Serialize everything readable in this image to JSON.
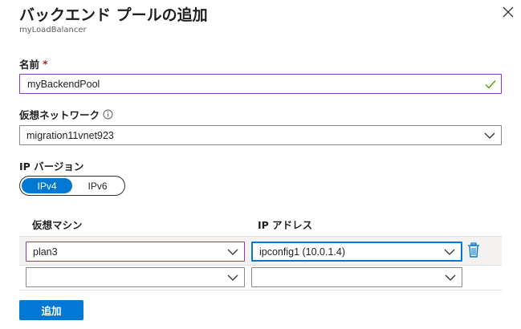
{
  "header": {
    "title": "バックエンド プールの追加",
    "subtitle": "myLoadBalancer"
  },
  "name_field": {
    "label": "名前",
    "required_mark": "*",
    "value": "myBackendPool"
  },
  "vnet_field": {
    "label": "仮想ネットワーク",
    "value": "migration11vnet923"
  },
  "ip_version": {
    "label": "IP バージョン",
    "options": [
      "IPv4",
      "IPv6"
    ],
    "selected": "IPv4"
  },
  "vm_table": {
    "col_vm": "仮想マシン",
    "col_ip": "IP アドレス",
    "rows": [
      {
        "vm": "plan3",
        "ip": "ipconfig1 (10.0.1.4)"
      },
      {
        "vm": "",
        "ip": ""
      }
    ]
  },
  "add_button": {
    "label": "追加"
  },
  "colors": {
    "accent": "#0078d4",
    "valid_border": "#8a3ab9",
    "check": "#57a300",
    "required": "#a4262c"
  }
}
